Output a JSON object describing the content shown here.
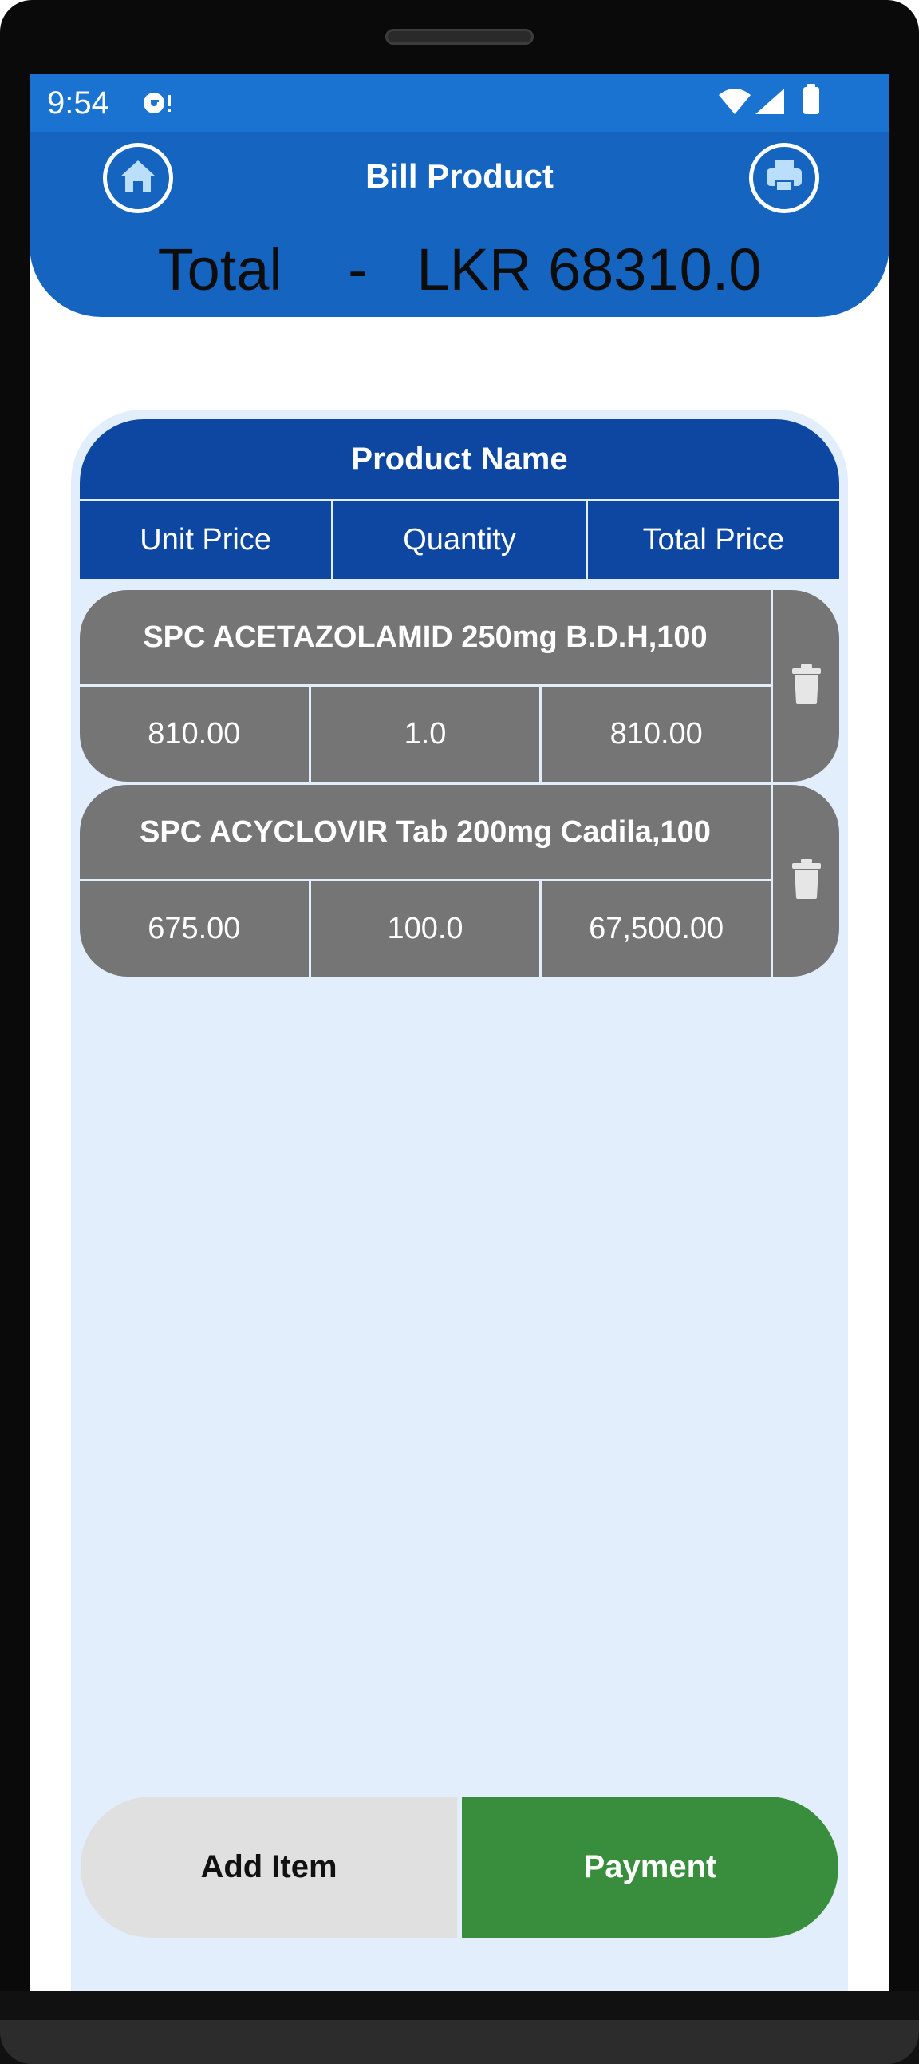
{
  "status_bar": {
    "time": "9:54",
    "icons": [
      "media-sync-icon",
      "wifi-icon",
      "cellular-signal-icon",
      "battery-icon"
    ]
  },
  "header": {
    "title": "Bill Product",
    "total": "Total    -   LKR 68310.0",
    "left_icon": "home-icon",
    "right_icon": "print-icon"
  },
  "table": {
    "product_name_header": "Product Name",
    "columns": [
      "Unit Price",
      "Quantity",
      "Total Price"
    ]
  },
  "items": [
    {
      "name": "SPC ACETAZOLAMID 250mg B.D.H,100",
      "unit_price": "810.00",
      "quantity": "1.0",
      "total_price": "810.00"
    },
    {
      "name": "SPC ACYCLOVIR Tab 200mg Cadila,100",
      "unit_price": "675.00",
      "quantity": "100.0",
      "total_price": "67,500.00"
    }
  ],
  "actions": {
    "add_item": "Add Item",
    "payment": "Payment"
  },
  "colors": {
    "status_bar": "#1a73d1",
    "header": "#1565c0",
    "table_header": "#0d47a1",
    "item_bg": "#757575",
    "panel_bg": "#e2eefb",
    "add_button": "#e0e0e0",
    "payment_button": "#388e3c"
  }
}
